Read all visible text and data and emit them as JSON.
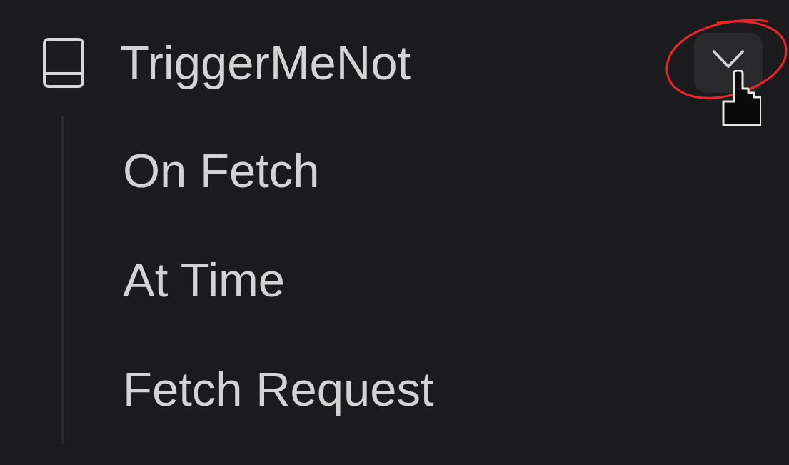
{
  "tree": {
    "items": [
      {
        "label": "TriggerMeNot",
        "expanded": true,
        "children": [
          {
            "label": "On Fetch"
          },
          {
            "label": "At Time"
          },
          {
            "label": "Fetch Request"
          }
        ]
      }
    ]
  }
}
